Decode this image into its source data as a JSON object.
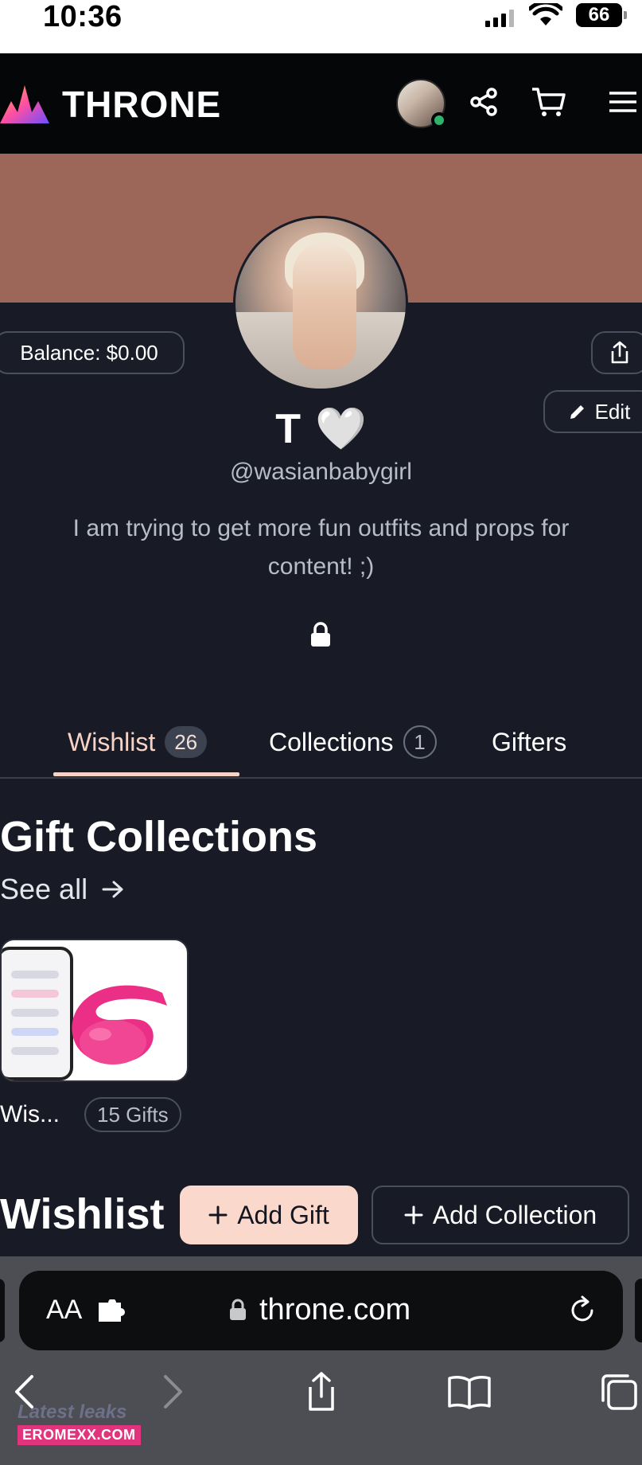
{
  "status_bar": {
    "time": "10:36",
    "battery": "66"
  },
  "header": {
    "brand": "THRONE"
  },
  "profile": {
    "balance_label": "Balance: $0.00",
    "edit_label": "Edit",
    "display_name": "T",
    "name_emoji": "🤍",
    "username": "@wasianbabygirl",
    "bio": "I am trying to get more fun outfits and props for content! ;)"
  },
  "tabs": [
    {
      "label": "Wishlist",
      "count": "26",
      "active": true
    },
    {
      "label": "Collections",
      "count": "1",
      "active": false
    },
    {
      "label": "Gifters",
      "active": false
    }
  ],
  "gift_collections": {
    "title": "Gift Collections",
    "see_all": "See all",
    "items": [
      {
        "label": "Wis...",
        "count": "15 Gifts"
      }
    ]
  },
  "wishlist": {
    "title": "Wishlist",
    "add_gift": "Add Gift",
    "add_collection": "Add Collection"
  },
  "browser": {
    "text_size": "AA",
    "url": "throne.com"
  },
  "watermark": {
    "line1": "Latest leaks",
    "line2": "EROMEXX.COM"
  },
  "colors": {
    "background": "#181b26",
    "banner": "#9c6759",
    "accent": "#f6d3c6",
    "add_gift_bg": "#fbd8cc",
    "online": "#2fb36b"
  },
  "icons": [
    "wifi-icon",
    "battery-icon",
    "throne-logo-icon",
    "share-icon",
    "cart-icon",
    "menu-icon",
    "export-icon",
    "pencil-icon",
    "lock-icon",
    "arrow-right-icon",
    "plus-icon",
    "puzzle-icon",
    "reload-icon",
    "back-icon",
    "forward-icon",
    "bookmarks-icon",
    "tabs-icon"
  ]
}
